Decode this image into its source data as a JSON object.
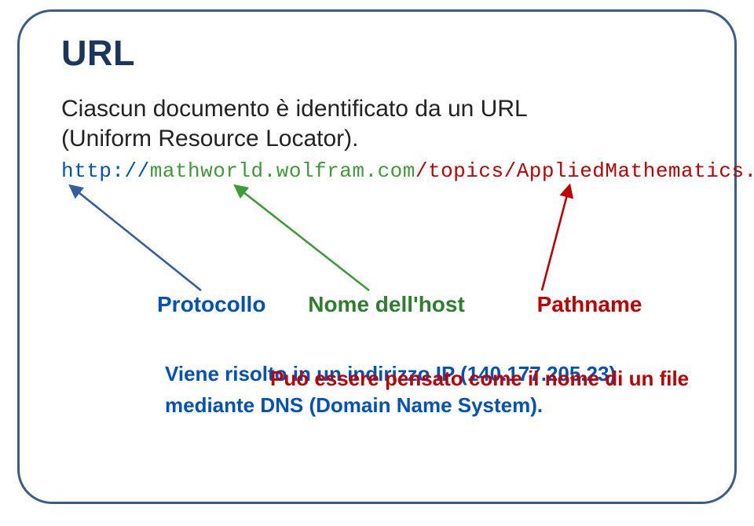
{
  "title": "URL",
  "intro_line1": "Ciascun documento è identificato da un URL",
  "intro_line2": "(Uniform Resource Locator).",
  "url": {
    "protocol": "http://",
    "host": "mathworld.wolfram.com",
    "path": "/topics/AppliedMathematics.html"
  },
  "labels": {
    "protocol": "Protocollo",
    "host": "Nome dell'host",
    "pathname": "Pathname"
  },
  "explain": {
    "resolved_ip": "Viene risolto in un indirizzo IP (140.177.205.23)",
    "pathname_hint": "Può essere pensato come il nome di un file",
    "dns": "mediante DNS (Domain Name System)."
  }
}
